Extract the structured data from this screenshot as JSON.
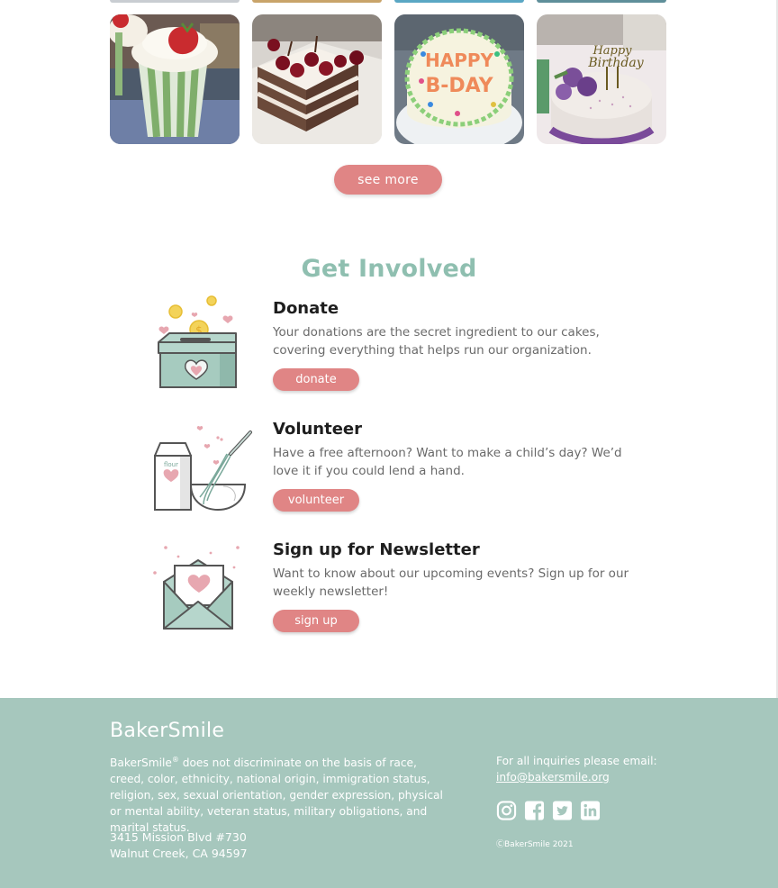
{
  "gallery": {
    "photos": [
      {
        "icon": "strawberry-cupcake-photo"
      },
      {
        "icon": "cherry-chocolate-cake-photo"
      },
      {
        "icon": "happy-bday-cake-photo",
        "cake_text_1": "HAPPY",
        "cake_text_2": "B-DAY"
      },
      {
        "icon": "happy-birthday-cake-photo",
        "topper_text_1": "Happy",
        "topper_text_2": "Birthday"
      }
    ],
    "see_more_label": "see more"
  },
  "get_involved": {
    "title": "Get Involved",
    "items": [
      {
        "icon": "donation-box-icon",
        "title": "Donate",
        "description": "Your donations are the secret ingredient to our cakes, covering everything that helps run our organization.",
        "button_label": "donate",
        "coin_symbol": "$"
      },
      {
        "icon": "flour-and-whisk-icon",
        "title": "Volunteer",
        "description": "Have a free afternoon? Want to make a child’s day? We’d love it if you could lend a hand.",
        "button_label": "volunteer",
        "flour_label": "flour"
      },
      {
        "icon": "envelope-heart-icon",
        "title": "Sign up for Newsletter",
        "description": "Want to know about our upcoming events? Sign up for our weekly newsletter!",
        "button_label": "sign up"
      }
    ]
  },
  "footer": {
    "brand": "BakerSmile",
    "disclaimer_name": "BakerSmile",
    "disclaimer_mark": "®",
    "disclaimer_text": " does not discriminate on the basis of race, creed, color, ethnicity, national origin, immigration status, religion, sex, sexual orientation, gender expression, physical or mental ability, veteran status, military obligations, and marital status.",
    "address_line1": "3415 Mission Blvd #730",
    "address_line2": "Walnut Creek, CA 94597",
    "inquiry_label": "For all inquiries please email:",
    "email": "info@bakersmile.org",
    "socials": [
      "instagram-icon",
      "facebook-icon",
      "twitter-icon",
      "linkedin-icon"
    ],
    "copyright": "ⒸBakerSmile 2021"
  },
  "colors": {
    "accent_pink": "#e08585",
    "title_green": "#8fbfb0",
    "footer_bg": "#a6c7bd"
  }
}
